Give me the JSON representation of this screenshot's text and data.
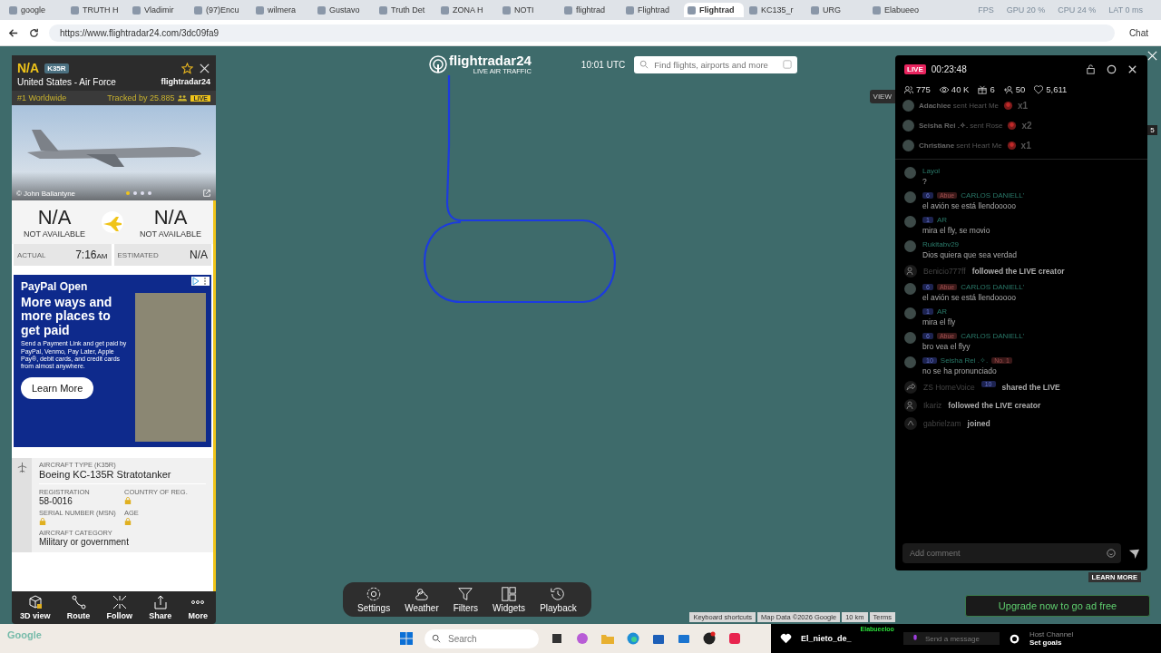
{
  "browser": {
    "tabs": [
      {
        "label": "google",
        "selected": false
      },
      {
        "label": "TRUTH H",
        "selected": false
      },
      {
        "label": "Vladimir",
        "selected": false
      },
      {
        "label": "(97)Encu",
        "selected": false
      },
      {
        "label": "wilmera",
        "selected": false
      },
      {
        "label": "Gustavo",
        "selected": false
      },
      {
        "label": "Truth Det",
        "selected": false
      },
      {
        "label": "ZONA H",
        "selected": false
      },
      {
        "label": "NOTI",
        "selected": false
      },
      {
        "label": "flightrad",
        "selected": false
      },
      {
        "label": "Flightrad",
        "selected": false
      },
      {
        "label": "Flightrad",
        "selected": true
      },
      {
        "label": "KC135_r",
        "selected": false
      },
      {
        "label": "URG",
        "selected": false
      },
      {
        "label": "Elabueeo",
        "selected": false
      }
    ],
    "perf": [
      "FPS",
      "GPU 20 %",
      "CPU 24 %",
      "LAT 0 ms"
    ],
    "url": "https://www.flightradar24.com/3dc09fa9",
    "chat_button": "Chat"
  },
  "flight_panel": {
    "callsign": "N/A",
    "type_code": "K35R",
    "operator": "United States - Air Force",
    "brand": "flightradar24",
    "rank": "#1 Worldwide",
    "tracked": "Tracked by 25.885",
    "live": "LIVE",
    "photo_credit": "© John Ballantyne",
    "photo_dots": [
      {
        "selected": true
      },
      {
        "selected": false
      },
      {
        "selected": false
      },
      {
        "selected": false
      }
    ],
    "origin": {
      "code": "N/A",
      "label": "NOT AVAILABLE"
    },
    "destination": {
      "code": "N/A",
      "label": "NOT AVAILABLE"
    },
    "times": [
      {
        "label": "ACTUAL",
        "value": "7:16",
        "suffix": "AM"
      },
      {
        "label": "ESTIMATED",
        "value": "N/A"
      }
    ],
    "ad": {
      "brand": "PayPal Open",
      "headline": "More ways and more places to get paid",
      "body": "Send a Payment Link and get paid by PayPal, Venmo, Pay Later, Apple Pay®, debit cards, and credit cards from almost anywhere.",
      "button": "Learn More"
    },
    "aircraft_type": {
      "label": "AIRCRAFT TYPE (K35R)",
      "value": "Boeing KC-135R Stratotanker"
    },
    "details": [
      {
        "label": "REGISTRATION",
        "value": "58-0016",
        "locked": false
      },
      {
        "label": "COUNTRY OF REG.",
        "locked": true
      },
      {
        "label": "SERIAL NUMBER (MSN)",
        "locked": true
      },
      {
        "label": "AGE",
        "locked": true
      }
    ],
    "category": {
      "label": "AIRCRAFT CATEGORY",
      "value": "Military or government"
    },
    "actions": [
      {
        "kind": "cube",
        "label": "3D view"
      },
      {
        "kind": "route",
        "label": "Route"
      },
      {
        "kind": "follow",
        "label": "Follow"
      },
      {
        "kind": "share",
        "label": "Share"
      },
      {
        "kind": "more",
        "label": "More"
      }
    ]
  },
  "map": {
    "logo": "flightradar24",
    "logo_sub": "LIVE AIR TRAFFIC",
    "time": "10:01 UTC",
    "search": {
      "placeholder": "Find flights, airports and more"
    },
    "view_tab": "VIEW",
    "toolbar": [
      {
        "kind": "settings",
        "label": "Settings"
      },
      {
        "kind": "weather",
        "label": "Weather"
      },
      {
        "kind": "filters",
        "label": "Filters"
      },
      {
        "kind": "widgets",
        "label": "Widgets"
      },
      {
        "kind": "playback",
        "label": "Playback"
      }
    ],
    "attribution": [
      "Keyboard shortcuts",
      "Map Data ©2026 Google",
      "10 km",
      "Terms"
    ],
    "google": "Google"
  },
  "live_chat": {
    "live": "LIVE",
    "timer": "00:23:48",
    "stats": [
      {
        "kind": "viewers",
        "value": "775"
      },
      {
        "kind": "views",
        "value": "40 K"
      },
      {
        "kind": "gifts",
        "value": "6"
      },
      {
        "kind": "followers",
        "value": "50"
      },
      {
        "kind": "likes",
        "value": "5,611"
      }
    ],
    "gifts": [
      {
        "user": "Adachiee",
        "text": "sent Heart Me",
        "count": "x1"
      },
      {
        "user": "Seisha Rei .✧.",
        "text": "sent Rose",
        "count": "x2"
      },
      {
        "user": "Christiane",
        "text": "sent Heart Me",
        "count": "x1"
      }
    ],
    "messages": [
      {
        "kind": "comment",
        "user": "Layol",
        "text": "?"
      },
      {
        "kind": "comment",
        "level": "6",
        "badge": "Abue",
        "user": "CARLOS DANIELL'",
        "text": "el avión se está llendooooo"
      },
      {
        "kind": "comment",
        "level": "1",
        "user": "AR",
        "text": "mira el fly, se movio"
      },
      {
        "kind": "comment",
        "user": "Rukitabv29",
        "text": "Dios quiera que sea verdad"
      },
      {
        "kind": "follow",
        "user": "Benicio777ff",
        "text": "followed the LIVE creator"
      },
      {
        "kind": "comment",
        "level": "6",
        "badge": "Abue",
        "user": "CARLOS DANIELL'",
        "text": "el avión se está llendooooo"
      },
      {
        "kind": "comment",
        "level": "1",
        "user": "AR",
        "text": "mira el fly"
      },
      {
        "kind": "comment",
        "level": "6",
        "badge": "Abue",
        "user": "CARLOS DANIELL'",
        "text": "bro vea el flyy"
      },
      {
        "kind": "comment",
        "level": "10",
        "user": "Seisha Rei .✧.",
        "badge": "No. 1",
        "text": "no se ha pronunciado"
      },
      {
        "kind": "share",
        "user": "ZS HomeVoice",
        "level": "10",
        "text": "shared the LIVE"
      },
      {
        "kind": "follow",
        "user": "Ikariz",
        "text": "followed the LIVE creator"
      },
      {
        "kind": "join",
        "user": "gabrielzam",
        "text": "joined"
      }
    ],
    "input": {
      "placeholder": "Add comment"
    },
    "stream_badge": "5",
    "learn_more": "LEARN MORE",
    "upgrade": "Upgrade now to go ad free"
  },
  "taskbar": {
    "search": {
      "placeholder": "Search"
    },
    "studio": {
      "user": "El_nieto_de_",
      "host": "Elabueeloo",
      "send": "Send a message",
      "channel": "Host Channel",
      "goals": "Set goals"
    }
  }
}
